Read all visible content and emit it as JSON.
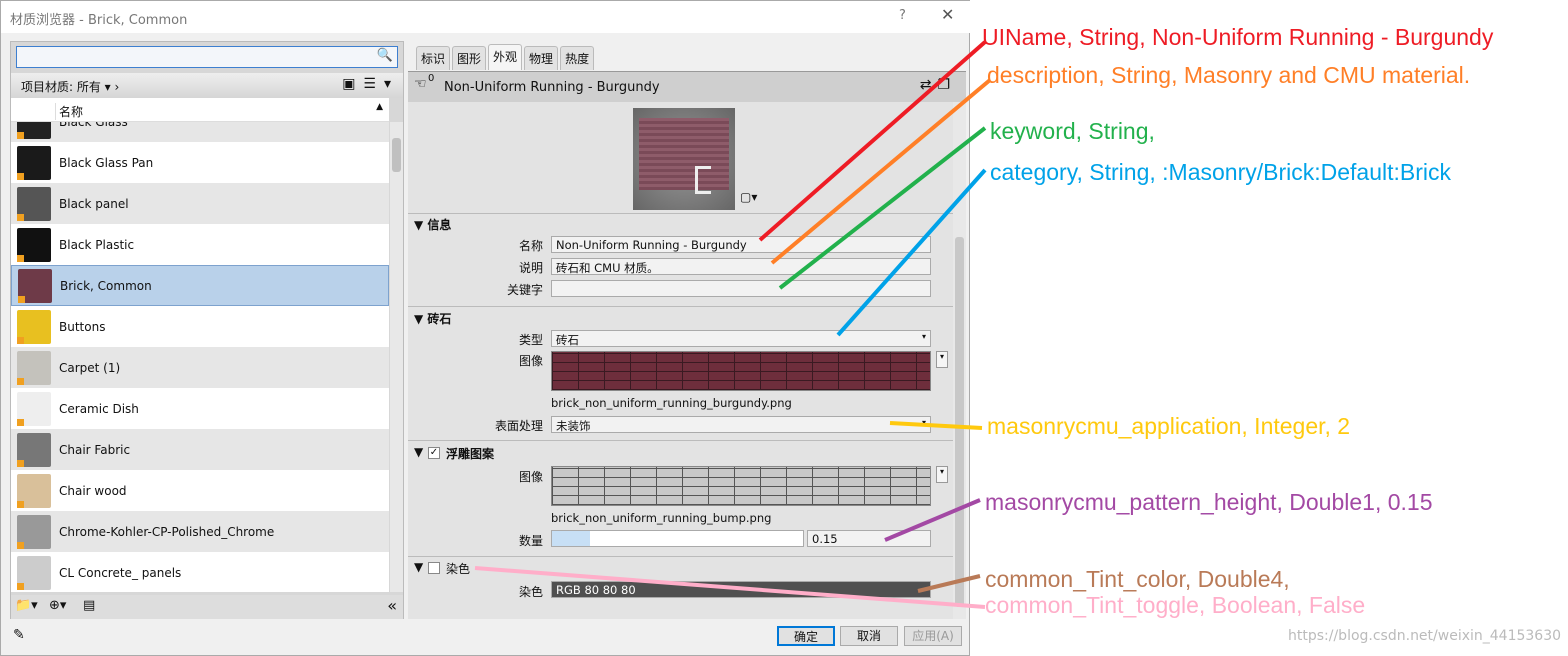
{
  "window": {
    "title": "材质浏览器 - Brick, Common",
    "help": "?",
    "close": "✕"
  },
  "left": {
    "search_value": "",
    "filter_label": "项目材质: 所有",
    "column_header": "名称",
    "items": [
      {
        "name": "Black Glass",
        "color": "#222"
      },
      {
        "name": "Black Glass Pan",
        "color": "#1a1a1a"
      },
      {
        "name": "Black panel",
        "color": "#555"
      },
      {
        "name": "Black Plastic",
        "color": "#111"
      },
      {
        "name": "Brick, Common",
        "color": "#6e3a48",
        "selected": true
      },
      {
        "name": "Buttons",
        "color": "#e8c020"
      },
      {
        "name": "Carpet (1)",
        "color": "#c4c2bc"
      },
      {
        "name": "Ceramic Dish",
        "color": "#eee"
      },
      {
        "name": "Chair Fabric",
        "color": "#777"
      },
      {
        "name": "Chair wood",
        "color": "#d9c09a"
      },
      {
        "name": "Chrome-Kohler-CP-Polished_Chrome",
        "color": "#999"
      },
      {
        "name": "CL Concrete_ panels",
        "color": "#ccc"
      }
    ]
  },
  "right": {
    "tabs": [
      "标识",
      "图形",
      "外观",
      "物理",
      "热度"
    ],
    "active_tab": "外观",
    "asset_name": "Non-Uniform Running - Burgundy",
    "usage_count": "0",
    "info": {
      "title": "信息",
      "name_label": "名称",
      "name_value": "Non-Uniform Running - Burgundy",
      "desc_label": "说明",
      "desc_value": "砖石和 CMU 材质。",
      "keyword_label": "关键字",
      "keyword_value": ""
    },
    "masonry": {
      "title": "砖石",
      "type_label": "类型",
      "type_value": "砖石",
      "image_label": "图像",
      "image_file": "brick_non_uniform_running_burgundy.png",
      "finish_label": "表面处理",
      "finish_value": "未装饰"
    },
    "relief": {
      "title": "浮雕图案",
      "checked": true,
      "image_label": "图像",
      "image_file": "brick_non_uniform_running_bump.png",
      "amount_label": "数量",
      "amount_value": "0.15",
      "amount_fraction": 0.15
    },
    "tint": {
      "title": "染色",
      "checked": false,
      "color_label": "染色",
      "color_value": "RGB 80 80 80",
      "color": "#505050"
    }
  },
  "buttons": {
    "ok": "确定",
    "cancel": "取消",
    "apply": "应用(A)"
  },
  "annotations": [
    {
      "text": "UIName, String, Non-Uniform Running - Burgundy",
      "color": "#ee1c25"
    },
    {
      "text": "description, String, Masonry and CMU material.",
      "color": "#ff7f27"
    },
    {
      "text": "keyword, String,",
      "color": "#22b14c"
    },
    {
      "text": "category, String, :Masonry/Brick:Default:Brick",
      "color": "#00a2e8"
    },
    {
      "text": "masonrycmu_application, Integer, 2",
      "color": "#ffc90e"
    },
    {
      "text": "masonrycmu_pattern_height, Double1, 0.15",
      "color": "#a349a4"
    },
    {
      "text": "common_Tint_color, Double4,",
      "color": "#b97a57"
    },
    {
      "text": "common_Tint_toggle, Boolean, False",
      "color": "#ffaec9"
    }
  ],
  "watermark": "https://blog.csdn.net/weixin_44153630"
}
